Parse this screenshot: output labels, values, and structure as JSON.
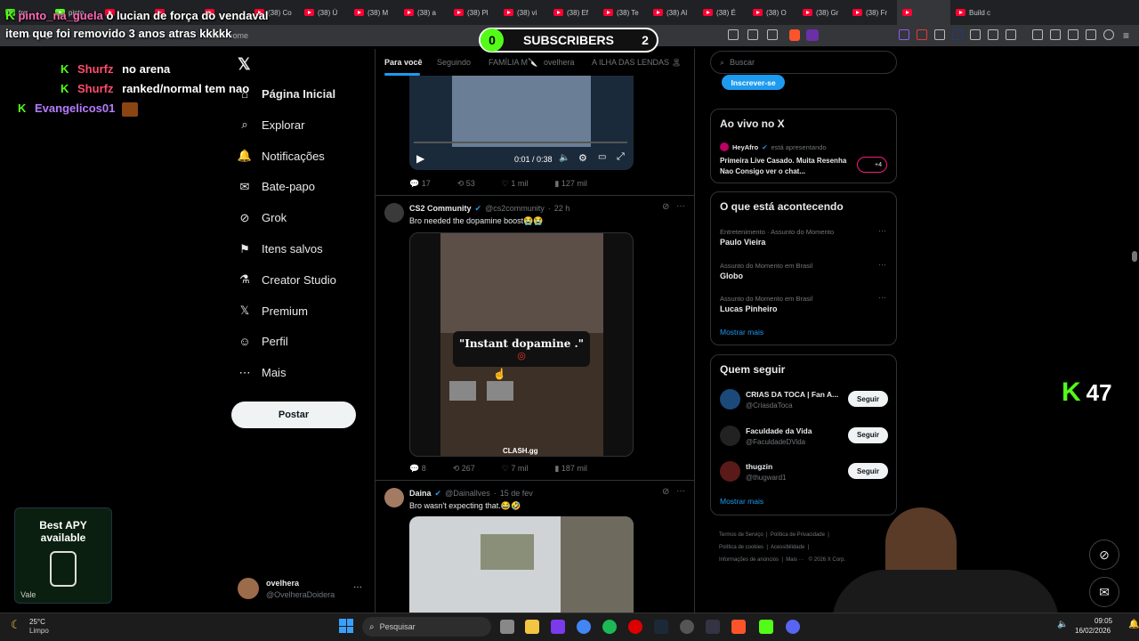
{
  "browser": {
    "tabs": [
      "tre",
      "pinto",
      "",
      "",
      "",
      "(38) Co",
      "(38) Ú",
      "(38) M",
      "(38) a",
      "(38) Pl",
      "(38) vi",
      "(38) Ef",
      "(38) Te",
      "(38) Al",
      "(38) É",
      "(38) O",
      "(38) Gr",
      "(38) Fr",
      "",
      "Build c"
    ],
    "address": "x.com/home"
  },
  "overlay": {
    "subscribers_label": "SUBSCRIBERS",
    "subscribers_left": "0",
    "subscribers_right": "2",
    "viewers": "47",
    "chat": [
      {
        "user": "pinto_na_guela",
        "msg": "o lucian de força do vendaval item que foi removido 3 anos atras kkkkk"
      },
      {
        "user": "Shurfz",
        "msg": "no arena"
      },
      {
        "user": "Shurfz",
        "msg": "ranked/normal tem nao"
      },
      {
        "user": "Evangelicos01",
        "msg": ""
      }
    ],
    "ad_line1": "Best APY",
    "ad_line2": "available",
    "ad_brand": "Vale"
  },
  "sidebar": {
    "items": [
      {
        "label": "Página Inicial",
        "icon": "home-icon"
      },
      {
        "label": "Explorar",
        "icon": "search-icon"
      },
      {
        "label": "Notificações",
        "icon": "bell-icon"
      },
      {
        "label": "Bate-papo",
        "icon": "mail-icon"
      },
      {
        "label": "Grok",
        "icon": "grok-icon"
      },
      {
        "label": "Itens salvos",
        "icon": "bookmark-icon"
      },
      {
        "label": "Creator Studio",
        "icon": "flask-icon"
      },
      {
        "label": "Premium",
        "icon": "x-logo-icon"
      },
      {
        "label": "Perfil",
        "icon": "person-icon"
      },
      {
        "label": "Mais",
        "icon": "more-icon"
      }
    ],
    "post_label": "Postar",
    "account_name": "ovelhera",
    "account_handle": "@OvelheraDoidera"
  },
  "feed": {
    "tabs": [
      "Para você",
      "Seguindo",
      "FAMÍLIA M🔪",
      "ovelhera",
      "A ILHA DAS LENDAS 🏝"
    ],
    "video1_time": "0:01 / 0:38",
    "post1_stats": {
      "replies": "17",
      "reposts": "53",
      "likes": "1 mil",
      "views": "127 mil"
    },
    "post2": {
      "name": "CS2 Community",
      "handle": "@cs2community",
      "time": "22 h",
      "text": "Bro needed the dopamine boost😭😭",
      "caption": "\"Instant dopamine .\"",
      "watermark": "CLASH.gg",
      "stats": {
        "replies": "8",
        "reposts": "267",
        "likes": "7 mil",
        "views": "187 mil"
      }
    },
    "post3": {
      "name": "Daina",
      "handle": "@Dainallves",
      "time": "15 de fev",
      "text": "Bro wasn't expecting that.😂🤣"
    }
  },
  "right": {
    "search_placeholder": "Buscar",
    "subscribe": "Inscrever-se",
    "live_title": "Ao vivo no X",
    "live_user": "HeyAfro",
    "live_presenting": "está apresentando",
    "live_text": "Primeira Live Casado. Muita Resenha Nao Consigo ver o chat...",
    "live_count": "+4",
    "happening_title": "O que está acontecendo",
    "trends": [
      {
        "context": "Entretenimento · Assunto do Momento",
        "name": "Paulo Vieira"
      },
      {
        "context": "Assunto do Momento em Brasil",
        "name": "Globo"
      },
      {
        "context": "Assunto do Momento em Brasil",
        "name": "Lucas Pinheiro"
      }
    ],
    "show_more": "Mostrar mais",
    "follow_title": "Quem seguir",
    "follow": [
      {
        "name": "CRIAS DA TOCA | Fan A...",
        "handle": "@CriasdaToca"
      },
      {
        "name": "Faculdade da Vida",
        "handle": "@FaculdadeDVida"
      },
      {
        "name": "thugzin",
        "handle": "@thugward1"
      }
    ],
    "follow_btn": "Seguir",
    "footer": [
      "Termos de Serviço",
      "Política de Privacidade",
      "Política de cookies",
      "Acessibilidade",
      "Informações de anúncios",
      "Mais ···",
      "© 2026 X Corp."
    ]
  },
  "taskbar": {
    "temp": "25°C",
    "weather": "Limpo",
    "search": "Pesquisar",
    "time": "09:05",
    "date": "16/02/2026"
  }
}
